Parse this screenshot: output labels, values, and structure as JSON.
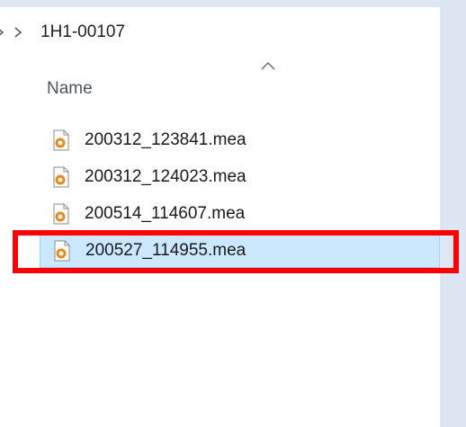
{
  "breadcrumb": {
    "current": "1H1-00107"
  },
  "columns": {
    "name_header": "Name",
    "sort_direction": "ascending"
  },
  "files": [
    {
      "name": "200312_123841.mea",
      "selected": false,
      "icon": "mea-file-icon"
    },
    {
      "name": "200312_124023.mea",
      "selected": false,
      "icon": "mea-file-icon"
    },
    {
      "name": "200514_114607.mea",
      "selected": false,
      "icon": "mea-file-icon"
    },
    {
      "name": "200527_114955.mea",
      "selected": true,
      "icon": "mea-file-icon"
    }
  ],
  "colors": {
    "selection_fill": "#cce8ff",
    "selection_border": "#99d1ff",
    "annotation_red": "#ff0000",
    "chrome_blue": "#dfe6f3"
  }
}
